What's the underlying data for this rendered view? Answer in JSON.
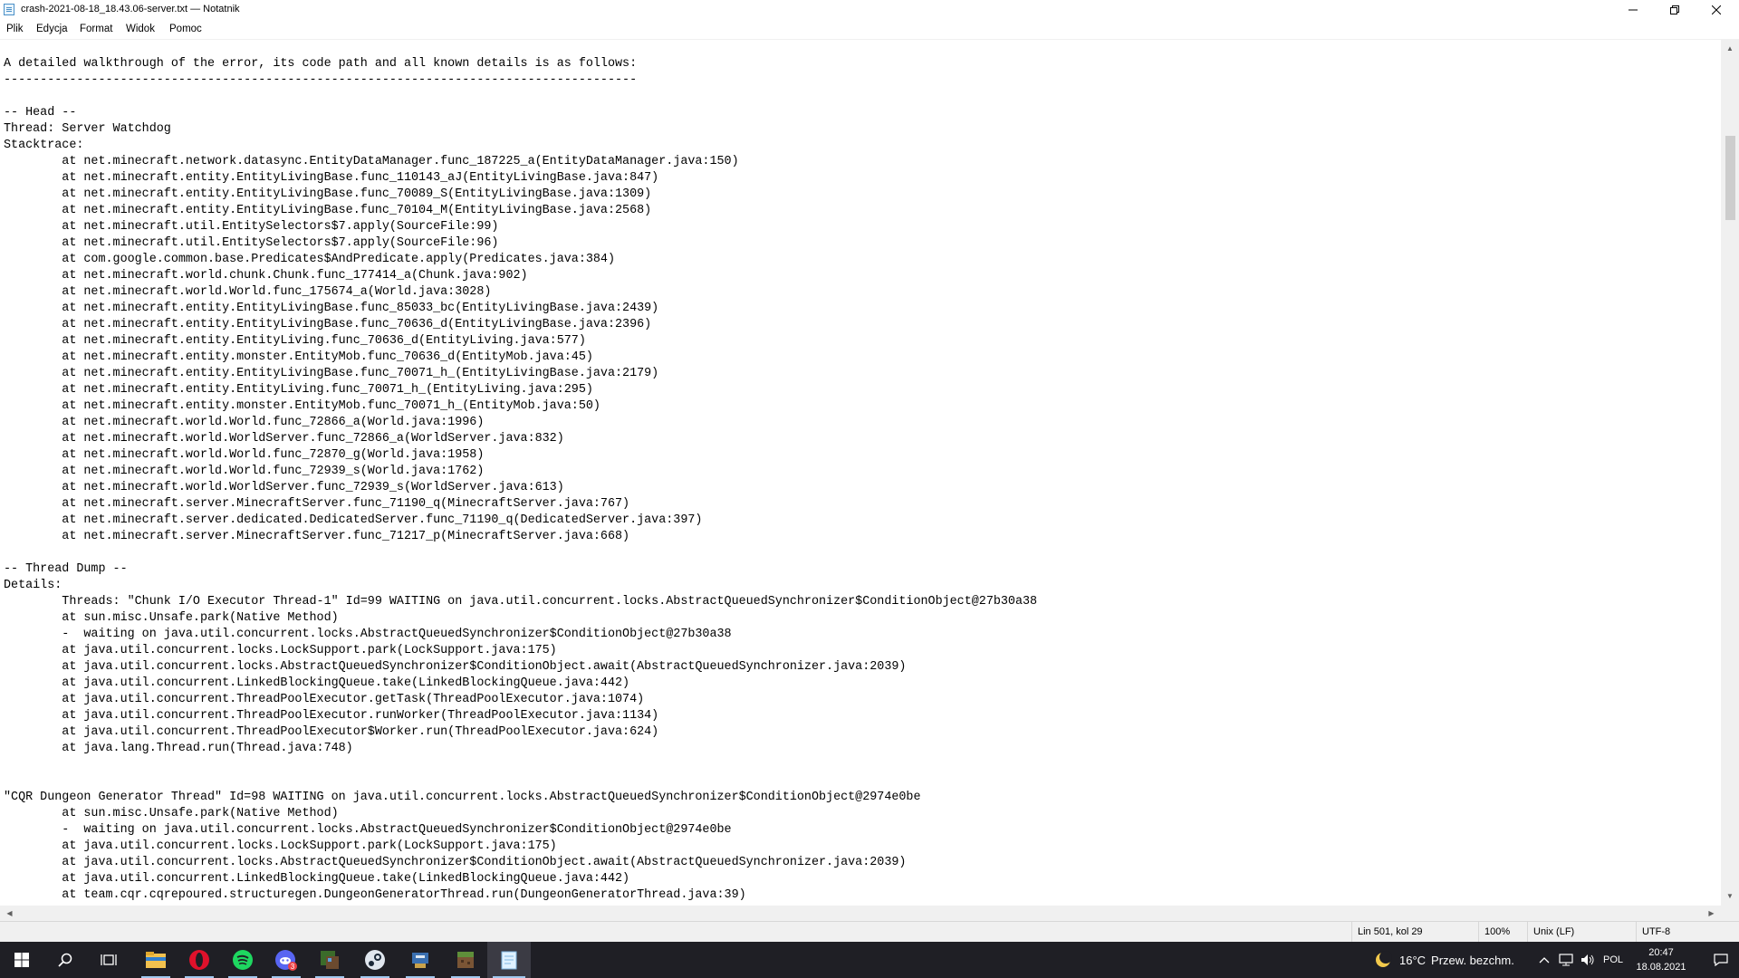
{
  "window": {
    "title": "crash-2021-08-18_18.43.06-server.txt — Notatnik",
    "icons": {
      "app": "notepad-icon",
      "minimize": "minimize-icon",
      "maximize": "restore-icon",
      "close": "close-icon"
    }
  },
  "menu": {
    "items": [
      "Plik",
      "Edycja",
      "Format",
      "Widok",
      "Pomoc"
    ]
  },
  "editor": {
    "lines": [
      "A detailed walkthrough of the error, its code path and all known details is as follows:",
      "---------------------------------------------------------------------------------------",
      "",
      "-- Head --",
      "Thread: Server Watchdog",
      "Stacktrace:",
      "\tat net.minecraft.network.datasync.EntityDataManager.func_187225_a(EntityDataManager.java:150)",
      "\tat net.minecraft.entity.EntityLivingBase.func_110143_aJ(EntityLivingBase.java:847)",
      "\tat net.minecraft.entity.EntityLivingBase.func_70089_S(EntityLivingBase.java:1309)",
      "\tat net.minecraft.entity.EntityLivingBase.func_70104_M(EntityLivingBase.java:2568)",
      "\tat net.minecraft.util.EntitySelectors$7.apply(SourceFile:99)",
      "\tat net.minecraft.util.EntitySelectors$7.apply(SourceFile:96)",
      "\tat com.google.common.base.Predicates$AndPredicate.apply(Predicates.java:384)",
      "\tat net.minecraft.world.chunk.Chunk.func_177414_a(Chunk.java:902)",
      "\tat net.minecraft.world.World.func_175674_a(World.java:3028)",
      "\tat net.minecraft.entity.EntityLivingBase.func_85033_bc(EntityLivingBase.java:2439)",
      "\tat net.minecraft.entity.EntityLivingBase.func_70636_d(EntityLivingBase.java:2396)",
      "\tat net.minecraft.entity.EntityLiving.func_70636_d(EntityLiving.java:577)",
      "\tat net.minecraft.entity.monster.EntityMob.func_70636_d(EntityMob.java:45)",
      "\tat net.minecraft.entity.EntityLivingBase.func_70071_h_(EntityLivingBase.java:2179)",
      "\tat net.minecraft.entity.EntityLiving.func_70071_h_(EntityLiving.java:295)",
      "\tat net.minecraft.entity.monster.EntityMob.func_70071_h_(EntityMob.java:50)",
      "\tat net.minecraft.world.World.func_72866_a(World.java:1996)",
      "\tat net.minecraft.world.WorldServer.func_72866_a(WorldServer.java:832)",
      "\tat net.minecraft.world.World.func_72870_g(World.java:1958)",
      "\tat net.minecraft.world.World.func_72939_s(World.java:1762)",
      "\tat net.minecraft.world.WorldServer.func_72939_s(WorldServer.java:613)",
      "\tat net.minecraft.server.MinecraftServer.func_71190_q(MinecraftServer.java:767)",
      "\tat net.minecraft.server.dedicated.DedicatedServer.func_71190_q(DedicatedServer.java:397)",
      "\tat net.minecraft.server.MinecraftServer.func_71217_p(MinecraftServer.java:668)",
      "",
      "-- Thread Dump --",
      "Details:",
      "\tThreads: \"Chunk I/O Executor Thread-1\" Id=99 WAITING on java.util.concurrent.locks.AbstractQueuedSynchronizer$ConditionObject@27b30a38",
      "\tat sun.misc.Unsafe.park(Native Method)",
      "\t-  waiting on java.util.concurrent.locks.AbstractQueuedSynchronizer$ConditionObject@27b30a38",
      "\tat java.util.concurrent.locks.LockSupport.park(LockSupport.java:175)",
      "\tat java.util.concurrent.locks.AbstractQueuedSynchronizer$ConditionObject.await(AbstractQueuedSynchronizer.java:2039)",
      "\tat java.util.concurrent.LinkedBlockingQueue.take(LinkedBlockingQueue.java:442)",
      "\tat java.util.concurrent.ThreadPoolExecutor.getTask(ThreadPoolExecutor.java:1074)",
      "\tat java.util.concurrent.ThreadPoolExecutor.runWorker(ThreadPoolExecutor.java:1134)",
      "\tat java.util.concurrent.ThreadPoolExecutor$Worker.run(ThreadPoolExecutor.java:624)",
      "\tat java.lang.Thread.run(Thread.java:748)",
      "",
      "",
      "\"CQR Dungeon Generator Thread\" Id=98 WAITING on java.util.concurrent.locks.AbstractQueuedSynchronizer$ConditionObject@2974e0be",
      "\tat sun.misc.Unsafe.park(Native Method)",
      "\t-  waiting on java.util.concurrent.locks.AbstractQueuedSynchronizer$ConditionObject@2974e0be",
      "\tat java.util.concurrent.locks.LockSupport.park(LockSupport.java:175)",
      "\tat java.util.concurrent.locks.AbstractQueuedSynchronizer$ConditionObject.await(AbstractQueuedSynchronizer.java:2039)",
      "\tat java.util.concurrent.LinkedBlockingQueue.take(LinkedBlockingQueue.java:442)",
      "\tat team.cqr.cqrepoured.structuregen.DungeonGeneratorThread.run(DungeonGeneratorThread.java:39)"
    ]
  },
  "statusbar": {
    "position": "Lin 501, kol 29",
    "zoom": "100%",
    "line_ending": "Unix (LF)",
    "encoding": "UTF-8"
  },
  "taskbar": {
    "apps": [
      {
        "icon": "windows-start-icon",
        "running": false
      },
      {
        "icon": "search-icon",
        "running": false
      },
      {
        "icon": "task-view-icon",
        "running": false
      },
      {
        "icon": "file-explorer-icon",
        "running": true
      },
      {
        "icon": "opera-icon",
        "running": true
      },
      {
        "icon": "spotify-icon",
        "running": true
      },
      {
        "icon": "discord-icon",
        "running": true,
        "badge": "3"
      },
      {
        "icon": "minecraft-launcher-icon",
        "running": true
      },
      {
        "icon": "steam-icon",
        "running": true
      },
      {
        "icon": "server-manager-icon",
        "running": true
      },
      {
        "icon": "minecraft-icon",
        "running": true
      },
      {
        "icon": "notepad-icon",
        "running": true,
        "active": true
      }
    ],
    "weather": {
      "temp": "16°C",
      "desc": "Przew. bezchm."
    },
    "language": "POL",
    "time": "20:47",
    "date": "18.08.2021"
  },
  "colors": {
    "accent": "#9ec7ee",
    "taskbar": "#1f1f25"
  }
}
